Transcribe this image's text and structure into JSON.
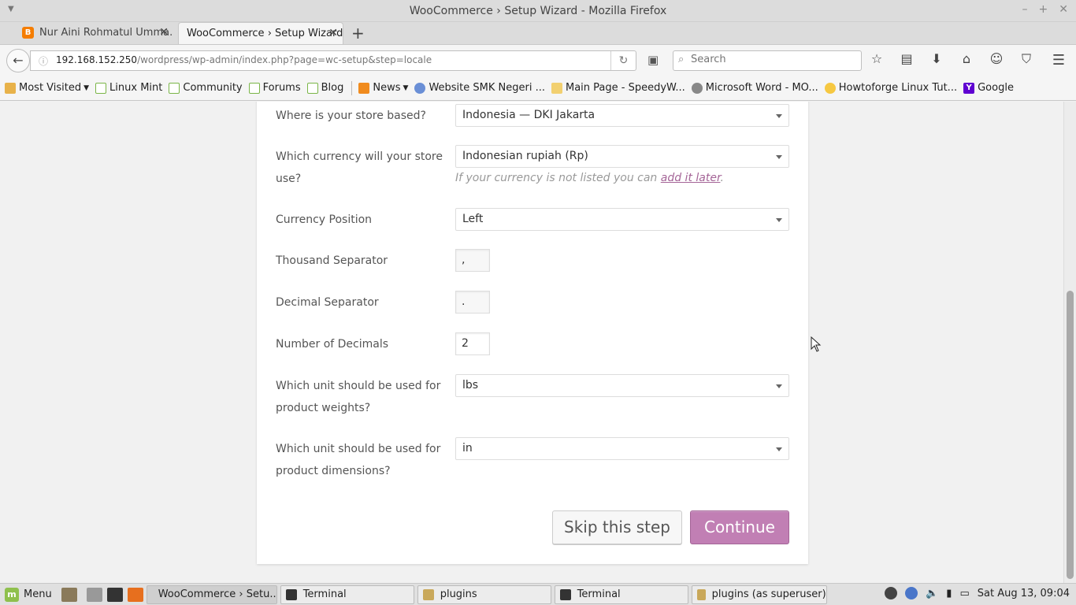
{
  "window": {
    "title": "WooCommerce › Setup Wizard - Mozilla Firefox"
  },
  "tabs": [
    {
      "label": "Nur Aini Rohmatul Umma...",
      "active": false
    },
    {
      "label": "WooCommerce › Setup Wizard",
      "active": true
    }
  ],
  "nav": {
    "url_host": "192.168.152.250",
    "url_path": "/wordpress/wp-admin/index.php?page=wc-setup&step=locale",
    "search_placeholder": "Search"
  },
  "bookmarks": [
    {
      "label": "Most Visited",
      "icon": "folder-icon"
    },
    {
      "label": "Linux Mint",
      "icon": "mint-icon"
    },
    {
      "label": "Community",
      "icon": "mint-icon"
    },
    {
      "label": "Forums",
      "icon": "mint-icon"
    },
    {
      "label": "Blog",
      "icon": "mint-icon"
    },
    {
      "label": "News",
      "icon": "rss-icon"
    },
    {
      "label": "Website SMK Negeri ...",
      "icon": "shield-icon"
    },
    {
      "label": "Main Page - SpeedyW...",
      "icon": "page-icon"
    },
    {
      "label": "Microsoft Word - MO...",
      "icon": "globe-icon"
    },
    {
      "label": "Howtoforge Linux Tut...",
      "icon": "bulb-icon"
    },
    {
      "label": "Google",
      "icon": "yahoo-icon"
    }
  ],
  "form": {
    "store_based_label": "Where is your store based?",
    "store_based_value": "Indonesia — DKI Jakarta",
    "currency_label": "Which currency will your store use?",
    "currency_value": "Indonesian rupiah (Rp)",
    "currency_hint_prefix": "If your currency is not listed you can ",
    "currency_hint_link": "add it later",
    "currency_hint_suffix": ".",
    "currency_position_label": "Currency Position",
    "currency_position_value": "Left",
    "thousand_sep_label": "Thousand Separator",
    "thousand_sep_value": ",",
    "decimal_sep_label": "Decimal Separator",
    "decimal_sep_value": ".",
    "num_decimals_label": "Number of Decimals",
    "num_decimals_value": "2",
    "weight_unit_label": "Which unit should be used for product weights?",
    "weight_unit_value": "lbs",
    "dimension_unit_label": "Which unit should be used for product dimensions?",
    "dimension_unit_value": "in",
    "skip_label": "Skip this step",
    "continue_label": "Continue"
  },
  "colors": {
    "accent": "#c17fb4",
    "link": "#a46497"
  },
  "taskbar": {
    "menu_label": "Menu",
    "items": [
      {
        "label": "WooCommerce › Setu...",
        "active": true
      },
      {
        "label": "Terminal",
        "active": false
      },
      {
        "label": "plugins",
        "active": false
      },
      {
        "label": "Terminal",
        "active": false
      },
      {
        "label": "plugins (as superuser)",
        "active": false
      }
    ],
    "clock": "Sat Aug 13, 09:04"
  }
}
